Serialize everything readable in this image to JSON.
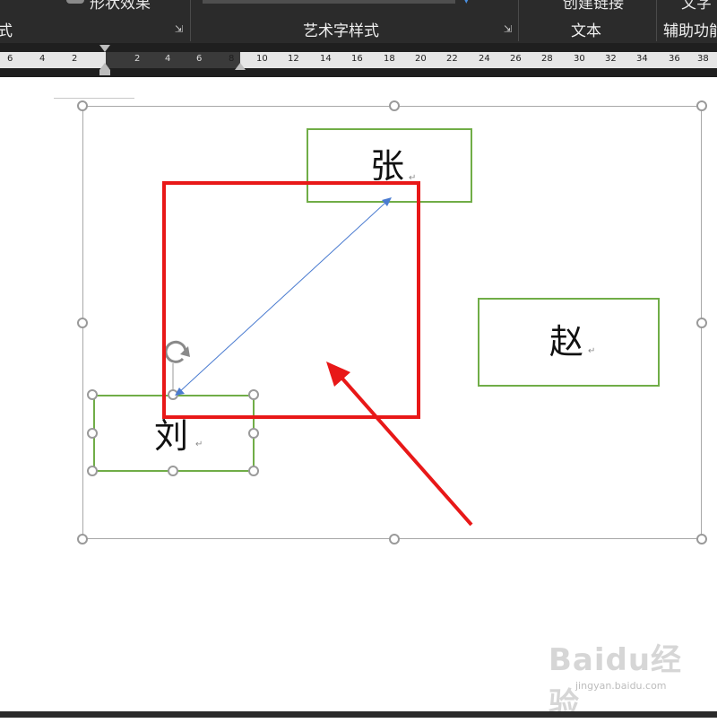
{
  "ribbon": {
    "top_partial_left": "形状效果",
    "top_partial_mid": "创建链接",
    "top_partial_right": "文字",
    "groups": {
      "shape_styles_label": "式",
      "wordart_styles_label": "艺术字样式",
      "text_label": "文本",
      "accessibility_label": "辅助功能"
    }
  },
  "ruler": {
    "left_ticks": [
      "6",
      "4",
      "2"
    ],
    "margin_ticks": [
      "2",
      "4",
      "6",
      "8"
    ],
    "right_ticks": [
      "10",
      "12",
      "14",
      "16",
      "18",
      "20",
      "22",
      "24",
      "26",
      "28",
      "30",
      "32",
      "34",
      "36",
      "38"
    ]
  },
  "canvas": {
    "textboxes": [
      {
        "id": "zhang",
        "text": "张"
      },
      {
        "id": "zhao",
        "text": "赵"
      },
      {
        "id": "liu",
        "text": "刘"
      }
    ],
    "paragraph_mark": "↵"
  },
  "annotation": {
    "highlight_color": "#e81818",
    "arrow_color": "#e81818",
    "connector_color": "#4a7bd0"
  },
  "watermark": {
    "main": "Baidu经验",
    "sub": "jingyan.baidu.com"
  },
  "icons": {
    "launcher": "dialog-launcher-icon",
    "rotate": "rotate-handle-icon"
  }
}
